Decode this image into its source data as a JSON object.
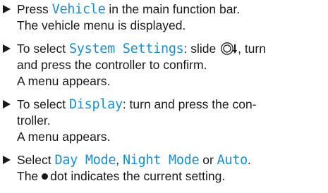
{
  "steps": [
    {
      "line1_pre": "Press ",
      "line1_hl": "Vehicle",
      "line1_post": " in the main function bar.",
      "line2": "The vehicle menu is displayed."
    },
    {
      "line1_pre": "To select ",
      "line1_hl": "System Settings",
      "line1_mid": ": slide ",
      "line1_post": ", turn",
      "line2": "and press the controller to confirm.",
      "line3": "A menu appears."
    },
    {
      "line1_pre": "To select ",
      "line1_hl": "Display",
      "line1_post": ": turn and press the con-",
      "line2": "troller.",
      "line3": "A menu appears."
    },
    {
      "line1_pre": "Select ",
      "line1_hl1": "Day Mode",
      "line1_sep1": ", ",
      "line1_hl2": "Night Mode",
      "line1_sep2": " or ",
      "line1_hl3": "Auto",
      "line1_end": ".",
      "line2_pre": "The",
      "line2_post": "dot indicates the current setting."
    }
  ],
  "colors": {
    "highlight": "#1a8fd0",
    "text": "#1a1a1a"
  },
  "icons": {
    "bullet": "right-triangle-bullet",
    "controller": "controller-slide-down-icon",
    "current": "filled-dot-icon"
  }
}
